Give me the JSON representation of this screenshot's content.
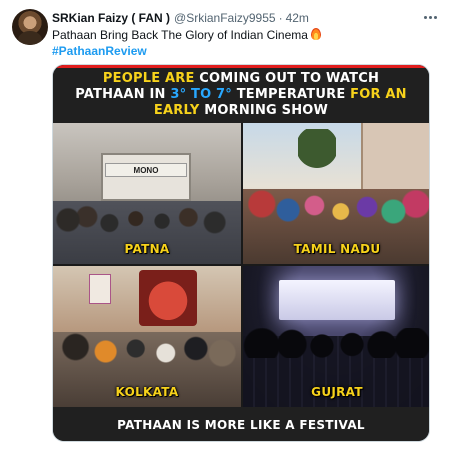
{
  "tweet": {
    "author_name": "SRKian Faizy ( FAN )",
    "author_handle": "@SrkianFaizy9955",
    "separator": "·",
    "time": "42m",
    "text": "Pathaan Bring Back The Glory of Indian Cinema",
    "emoji": "fire-emoji",
    "hashtag": "#PathaanReview"
  },
  "media": {
    "headline_line1_a": "PEOPLE ARE",
    "headline_line1_b": " COMING OUT TO WATCH",
    "headline_line2_a": "PATHAAN IN ",
    "headline_line2_b": "3° TO 7°",
    "headline_line2_c": " TEMPERATURE ",
    "headline_line2_d": "FOR AN",
    "headline_line3_a": "EARLY",
    "headline_line3_b": " MORNING SHOW",
    "cells": [
      {
        "label": "PATNA",
        "sign": "MONO"
      },
      {
        "label": "TAMIL NADU"
      },
      {
        "label": "KOLKATA"
      },
      {
        "label": "GUJRAT"
      }
    ],
    "footer": "PATHAAN IS MORE LIKE A FESTIVAL"
  },
  "colors": {
    "accent_yellow": "#f7d21b",
    "accent_blue": "#29a8ff",
    "hashtag_blue": "#1d9bf0",
    "red_bar": "#e11d1d"
  }
}
